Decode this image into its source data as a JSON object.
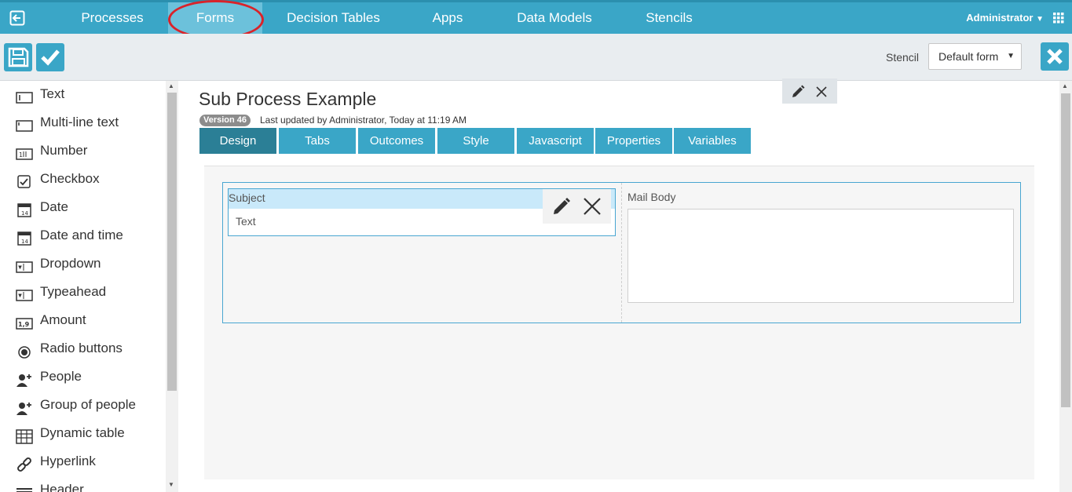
{
  "nav": {
    "items": [
      {
        "label": "Processes"
      },
      {
        "label": "Forms"
      },
      {
        "label": "Decision Tables"
      },
      {
        "label": "Apps"
      },
      {
        "label": "Data Models"
      },
      {
        "label": "Stencils"
      }
    ],
    "active": "Forms",
    "user": "Administrator",
    "highlight_color": "#d9232a"
  },
  "toolbar": {
    "stencil_label": "Stencil",
    "stencil_value": "Default form"
  },
  "palette": {
    "items": [
      {
        "label": "Text",
        "icon": "text-field-icon"
      },
      {
        "label": "Multi-line text",
        "icon": "multiline-text-icon"
      },
      {
        "label": "Number",
        "icon": "number-icon"
      },
      {
        "label": "Checkbox",
        "icon": "checkbox-icon"
      },
      {
        "label": "Date",
        "icon": "calendar-icon"
      },
      {
        "label": "Date and time",
        "icon": "calendar-icon"
      },
      {
        "label": "Dropdown",
        "icon": "dropdown-icon"
      },
      {
        "label": "Typeahead",
        "icon": "typeahead-icon"
      },
      {
        "label": "Amount",
        "icon": "amount-icon"
      },
      {
        "label": "Radio buttons",
        "icon": "radio-icon"
      },
      {
        "label": "People",
        "icon": "person-add-icon"
      },
      {
        "label": "Group of people",
        "icon": "group-add-icon"
      },
      {
        "label": "Dynamic table",
        "icon": "table-icon"
      },
      {
        "label": "Hyperlink",
        "icon": "link-icon"
      },
      {
        "label": "Header",
        "icon": "header-icon"
      }
    ]
  },
  "form": {
    "title": "Sub Process Example",
    "version": "Version 46",
    "last_updated": "Last updated by Administrator, Today at 11:19 AM",
    "tabs": [
      {
        "label": "Design"
      },
      {
        "label": "Tabs"
      },
      {
        "label": "Outcomes"
      },
      {
        "label": "Style"
      },
      {
        "label": "Javascript"
      },
      {
        "label": "Properties"
      },
      {
        "label": "Variables"
      }
    ],
    "active_tab": "Design",
    "fields": {
      "subject_label": "Subject",
      "subject_type": "Text",
      "mail_body_label": "Mail Body"
    }
  },
  "colors": {
    "primary": "#3aa6c7",
    "active_tab": "#2b7f96",
    "selected_field": "#c9e9fa"
  }
}
